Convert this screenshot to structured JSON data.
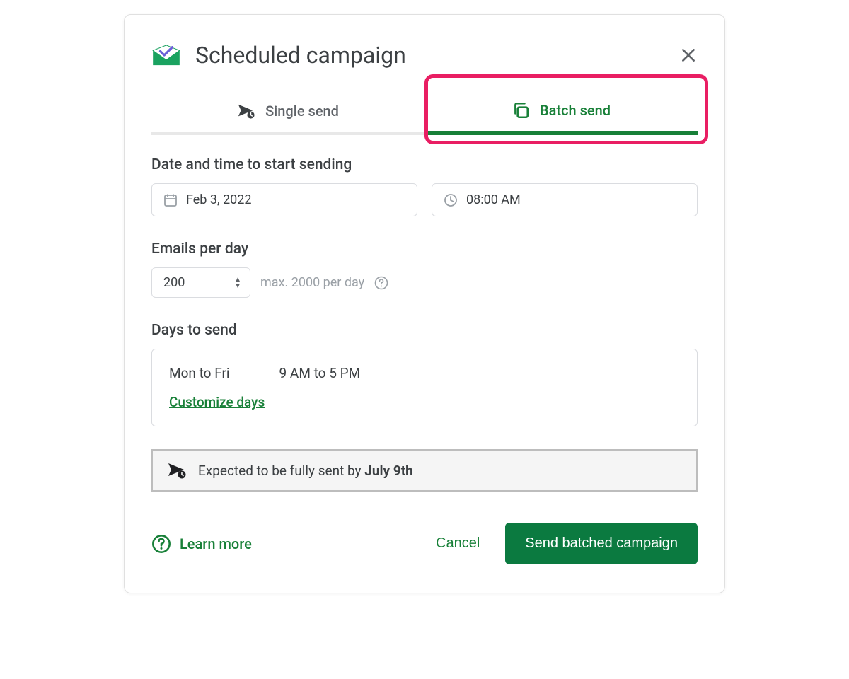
{
  "dialog": {
    "title": "Scheduled campaign"
  },
  "tabs": {
    "single": "Single send",
    "batch": "Batch send"
  },
  "datetime": {
    "label": "Date and time to start sending",
    "date": "Feb 3, 2022",
    "time": "08:00 AM"
  },
  "emails": {
    "label": "Emails per day",
    "value": "200",
    "hint": "max. 2000 per day"
  },
  "days": {
    "label": "Days to send",
    "range": "Mon to Fri",
    "hours": "9 AM to 5 PM",
    "customize": "Customize days"
  },
  "expected": {
    "prefix": "Expected to be fully sent by ",
    "date": "July 9th"
  },
  "footer": {
    "learn": "Learn more",
    "cancel": "Cancel",
    "send": "Send batched campaign"
  }
}
